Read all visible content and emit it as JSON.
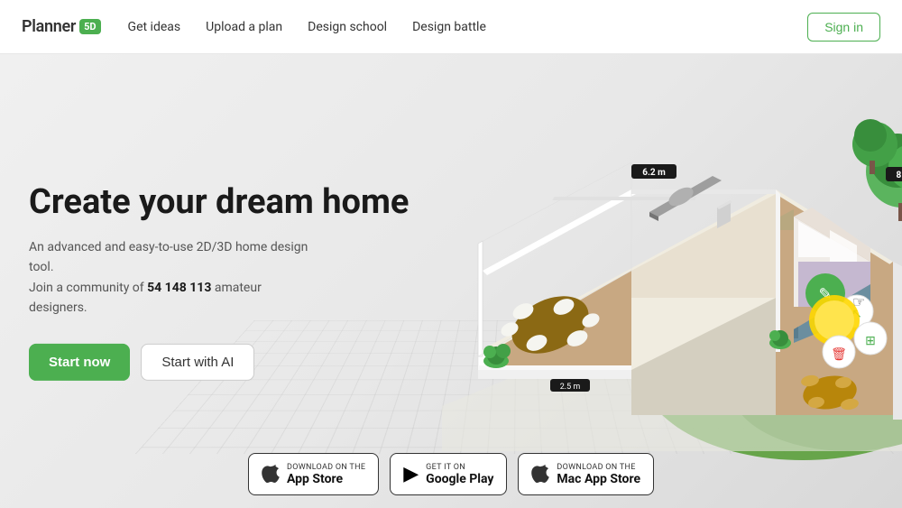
{
  "navbar": {
    "logo_text": "Planner",
    "logo_badge": "5D",
    "links": [
      {
        "label": "Get ideas",
        "id": "get-ideas"
      },
      {
        "label": "Upload a plan",
        "id": "upload-plan"
      },
      {
        "label": "Design school",
        "id": "design-school"
      },
      {
        "label": "Design battle",
        "id": "design-battle"
      }
    ],
    "signin_label": "Sign in"
  },
  "hero": {
    "title": "Create your dream home",
    "desc_line1": "An advanced and easy-to-use 2D/3D home design tool.",
    "desc_line2": "Join a community of",
    "community_count": "54 148 113",
    "desc_line3": "amateur designers.",
    "btn_start_now": "Start now",
    "btn_start_ai": "Start with AI"
  },
  "store_badges": [
    {
      "id": "app-store",
      "sub": "Download on the",
      "main": "App Store",
      "icon": "apple"
    },
    {
      "id": "google-play",
      "sub": "GET IT ON",
      "main": "Google Play",
      "icon": "play"
    },
    {
      "id": "mac-app-store",
      "sub": "Download on the",
      "main": "Mac App Store",
      "icon": "apple"
    }
  ]
}
